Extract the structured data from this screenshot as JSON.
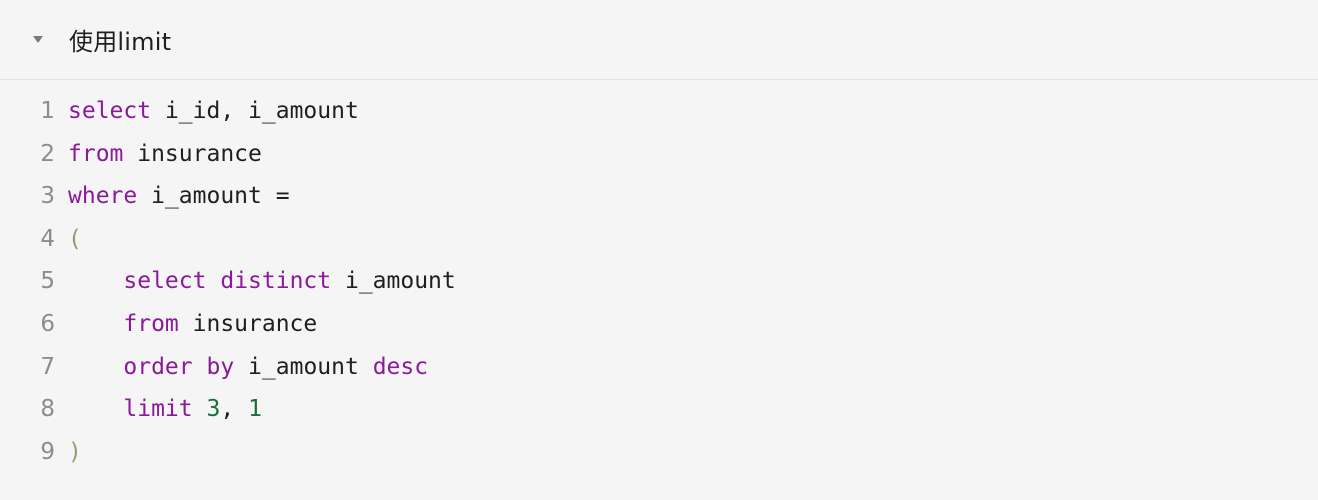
{
  "section": {
    "title": "使用limit",
    "toggle_icon": "caret-down-icon"
  },
  "code": {
    "language": "sql",
    "colors": {
      "keyword": "#8a1a9a",
      "number": "#1a6e3c",
      "paren": "#9a9a72",
      "text": "#1f1f1f",
      "line_number": "#8c8c8c"
    },
    "lines": [
      {
        "n": "1",
        "tokens": [
          {
            "t": "kw",
            "v": "select"
          },
          {
            "t": "plain",
            "v": " i_id, i_amount"
          }
        ]
      },
      {
        "n": "2",
        "tokens": [
          {
            "t": "kw",
            "v": "from"
          },
          {
            "t": "plain",
            "v": " insurance"
          }
        ]
      },
      {
        "n": "3",
        "tokens": [
          {
            "t": "kw",
            "v": "where"
          },
          {
            "t": "plain",
            "v": " i_amount ="
          }
        ]
      },
      {
        "n": "4",
        "tokens": [
          {
            "t": "paren",
            "v": "("
          }
        ]
      },
      {
        "n": "5",
        "tokens": [
          {
            "t": "plain",
            "v": "    "
          },
          {
            "t": "kw",
            "v": "select"
          },
          {
            "t": "plain",
            "v": " "
          },
          {
            "t": "kw",
            "v": "distinct"
          },
          {
            "t": "plain",
            "v": " i_amount"
          }
        ]
      },
      {
        "n": "6",
        "tokens": [
          {
            "t": "plain",
            "v": "    "
          },
          {
            "t": "kw",
            "v": "from"
          },
          {
            "t": "plain",
            "v": " insurance"
          }
        ]
      },
      {
        "n": "7",
        "tokens": [
          {
            "t": "plain",
            "v": "    "
          },
          {
            "t": "kw",
            "v": "order"
          },
          {
            "t": "plain",
            "v": " "
          },
          {
            "t": "kw",
            "v": "by"
          },
          {
            "t": "plain",
            "v": " i_amount "
          },
          {
            "t": "kw",
            "v": "desc"
          }
        ]
      },
      {
        "n": "8",
        "tokens": [
          {
            "t": "plain",
            "v": "    "
          },
          {
            "t": "kw",
            "v": "limit"
          },
          {
            "t": "plain",
            "v": " "
          },
          {
            "t": "num",
            "v": "3"
          },
          {
            "t": "plain",
            "v": ", "
          },
          {
            "t": "num",
            "v": "1"
          }
        ]
      },
      {
        "n": "9",
        "tokens": [
          {
            "t": "paren",
            "v": ")"
          }
        ]
      }
    ]
  }
}
